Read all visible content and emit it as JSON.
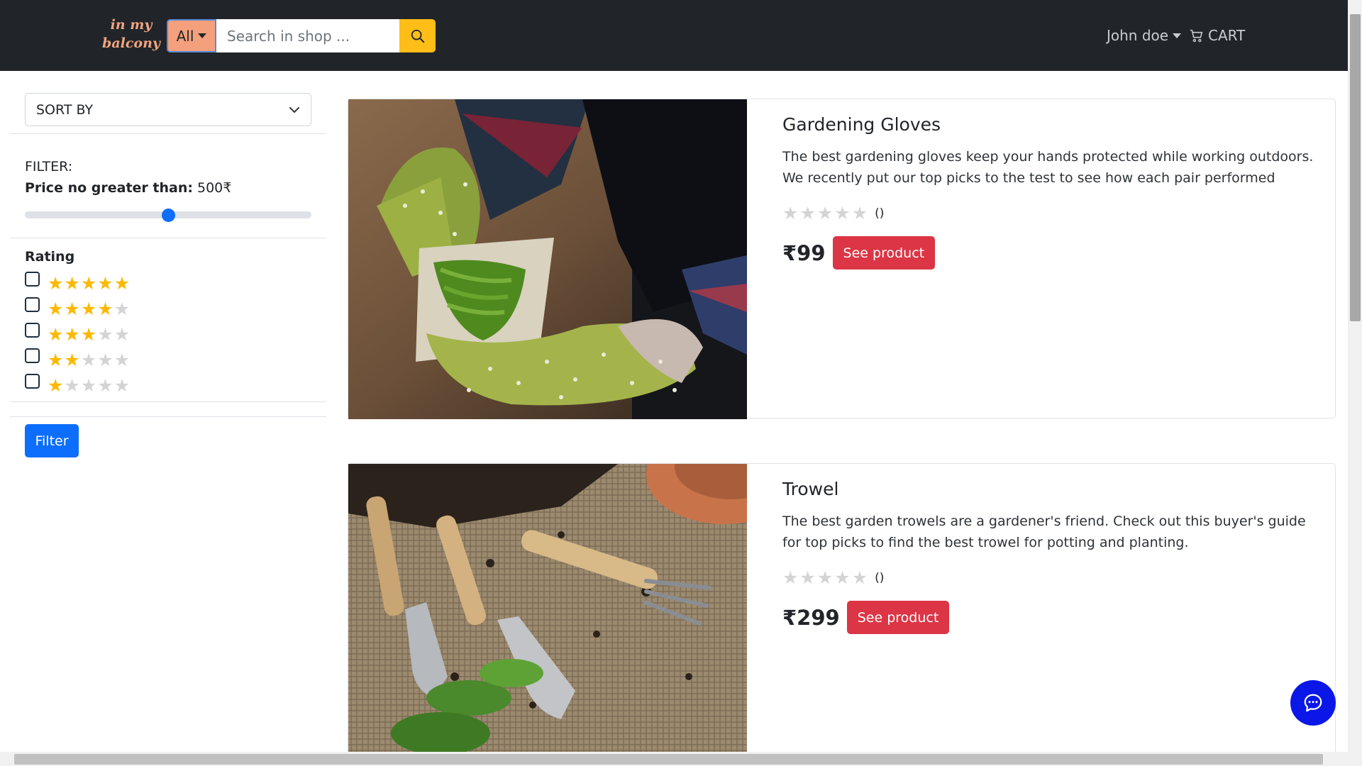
{
  "brand": {
    "line1": "in my",
    "line2": "balcony"
  },
  "search": {
    "category": "All",
    "placeholder": "Search in shop ...",
    "icon": "search-icon"
  },
  "nav": {
    "user": "John doe",
    "cart": "CART",
    "cart_icon": "cart-icon"
  },
  "sidebar": {
    "sort_label": "SORT BY",
    "filter_title": "FILTER:",
    "price_label": "Price no greater than:",
    "price_value": "500₹",
    "price_slider_fraction": 0.5,
    "rating_title": "Rating",
    "rating_options": [
      5,
      4,
      3,
      2,
      1
    ],
    "filter_button": "Filter"
  },
  "products": [
    {
      "title": "Gardening Gloves",
      "description": "The best gardening gloves keep your hands protected while working outdoors. We recently put our top picks to the test to see how each pair performed",
      "rating": 0,
      "rating_count": "()",
      "price": "₹99",
      "button": "See product"
    },
    {
      "title": "Trowel",
      "description": "The best garden trowels are a gardener's friend. Check out this buyer's guide for top picks to find the best trowel for potting and planting.",
      "rating": 0,
      "rating_count": "()",
      "price": "₹299",
      "button": "See product"
    }
  ],
  "colors": {
    "navbar": "#212529",
    "accent_search": "#febd17",
    "category": "#f4a07c",
    "primary": "#0d6efd",
    "danger": "#dc3545",
    "chat": "#0a17e8"
  }
}
